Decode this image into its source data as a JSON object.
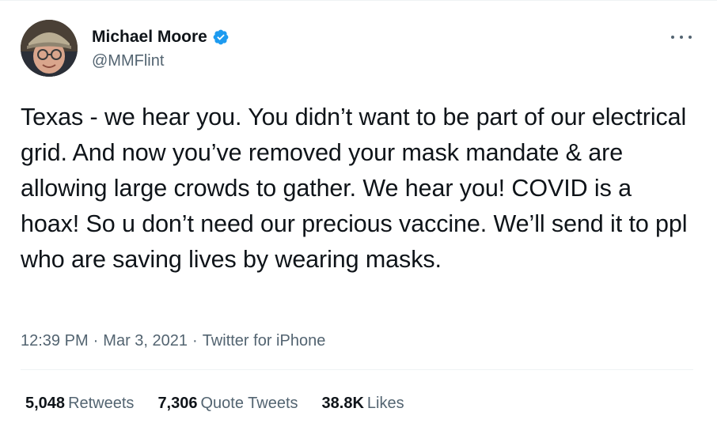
{
  "author": {
    "name": "Michael Moore",
    "handle": "@MMFlint",
    "verified": true
  },
  "icons": {
    "verified": "verified-badge-icon",
    "more": "more-options-icon"
  },
  "tweet": {
    "text": "Texas - we hear you. You didn’t want to be part of our electrical grid. And now you’ve removed your mask mandate & are allowing large crowds to gather. We hear you! COVID is a hoax! So u don’t need our precious vaccine. We’ll send it to ppl who are saving lives by wearing masks.",
    "time": "12:39 PM",
    "date": "Mar 3, 2021",
    "source": "Twitter for iPhone",
    "separator": "·"
  },
  "stats": {
    "retweets": {
      "count": "5,048",
      "label": "Retweets"
    },
    "quote_tweets": {
      "count": "7,306",
      "label": "Quote Tweets"
    },
    "likes": {
      "count": "38.8K",
      "label": "Likes"
    }
  },
  "colors": {
    "text_primary": "#0f1419",
    "text_secondary": "#536471",
    "verified_blue": "#1d9bf0",
    "divider": "#eff3f4"
  }
}
